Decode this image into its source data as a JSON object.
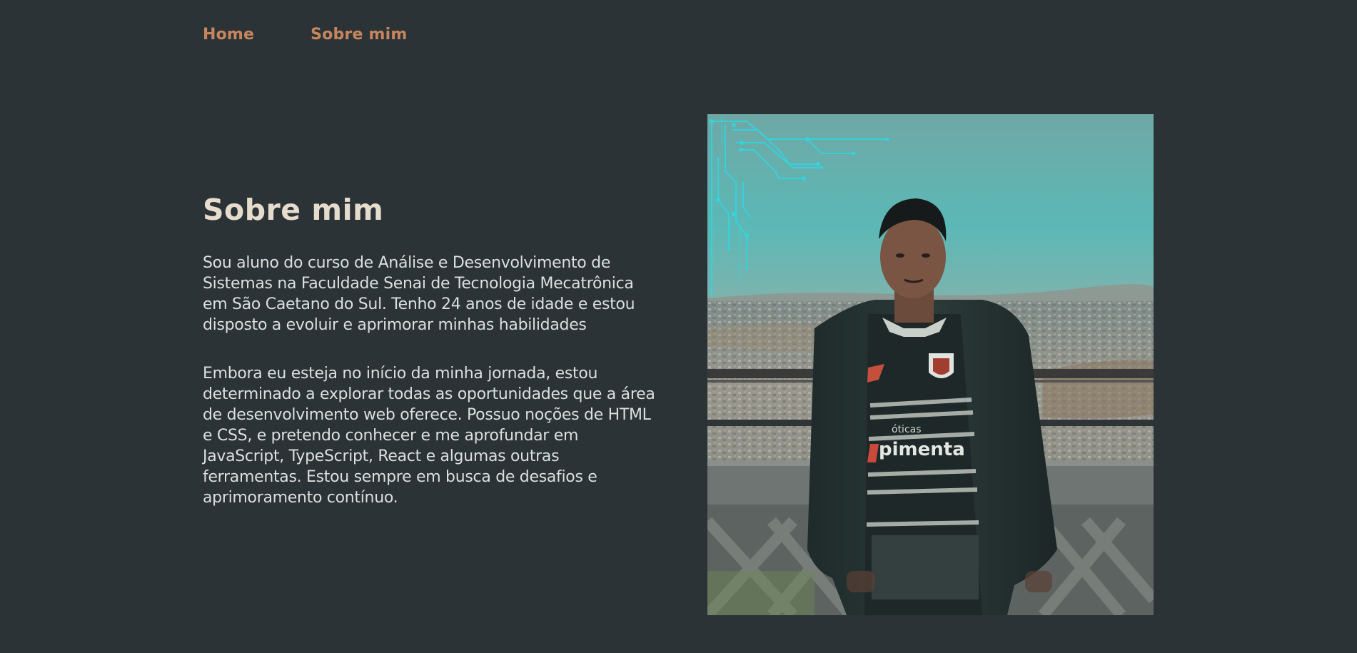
{
  "nav": {
    "items": [
      {
        "label": "Home"
      },
      {
        "label": "Sobre mim"
      }
    ]
  },
  "about": {
    "title": "Sobre mim",
    "paragraphs": [
      "Sou aluno do curso de Análise e Desenvolvimento de Sistemas na Faculdade Senai de Tecnologia Mecatrônica em São Caetano do Sul. Tenho 24 anos de idade e estou disposto a evoluir e aprimorar minhas habilidades",
      "Embora eu esteja no início da minha jornada, estou determinado a explorar todas as oportunidades que a área de desenvolvimento web oferece. Possuo noções de HTML e CSS, e pretendo conhecer e me aprofundar em JavaScript, TypeScript, React e algumas outras ferramentas. Estou sempre em busca de desafios e aprimoramento contínuo."
    ]
  },
  "photo": {
    "shirt_text": "pimenta",
    "shirt_small_text": "óticas"
  },
  "colors": {
    "background": "#2b3336",
    "nav_link": "#c6855e",
    "heading": "#e6dccd",
    "body_text": "#dedede",
    "circuit": "#35d3de"
  }
}
